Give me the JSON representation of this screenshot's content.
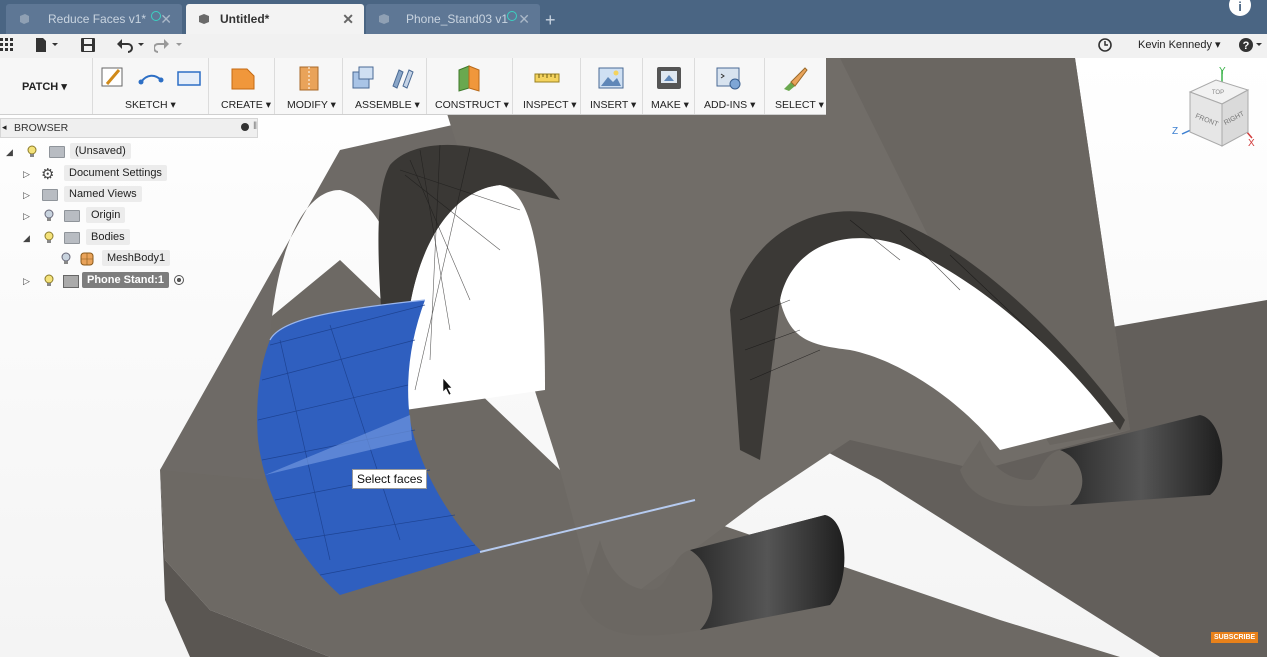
{
  "tabs": [
    {
      "label": "Reduce Faces v1*",
      "state": "inactive"
    },
    {
      "label": "Untitled*",
      "state": "active"
    },
    {
      "label": "Phone_Stand03 v1",
      "state": "inactive"
    }
  ],
  "quickbar": {
    "user_name": "Kevin Kennedy",
    "icons": [
      "apps-grid-icon",
      "file-icon",
      "save-icon",
      "undo-icon",
      "redo-icon",
      "clock-icon",
      "help-icon"
    ]
  },
  "toolbar": {
    "workspace": "PATCH",
    "groups": [
      {
        "label": "SKETCH"
      },
      {
        "label": "CREATE"
      },
      {
        "label": "MODIFY"
      },
      {
        "label": "ASSEMBLE"
      },
      {
        "label": "CONSTRUCT"
      },
      {
        "label": "INSPECT"
      },
      {
        "label": "INSERT"
      },
      {
        "label": "MAKE"
      },
      {
        "label": "ADD-INS"
      },
      {
        "label": "SELECT"
      }
    ]
  },
  "browser": {
    "title": "BROWSER",
    "items": [
      {
        "label": "(Unsaved)"
      },
      {
        "label": "Document Settings"
      },
      {
        "label": "Named Views"
      },
      {
        "label": "Origin"
      },
      {
        "label": "Bodies"
      },
      {
        "label": "MeshBody1"
      },
      {
        "label": "Phone Stand:1"
      }
    ]
  },
  "viewcube": {
    "front": "FRONT",
    "right": "RIGHT",
    "top": "TOP",
    "axes": [
      "Y",
      "Z",
      "X"
    ]
  },
  "tooltip": "Select faces",
  "badge": "SUBSCRIBE",
  "colors": {
    "tab_bar": "#4a6583",
    "mesh_body": "#6b6762",
    "selected_faces": "#2f5fbf",
    "accent_teal": "#3bd1c2"
  }
}
